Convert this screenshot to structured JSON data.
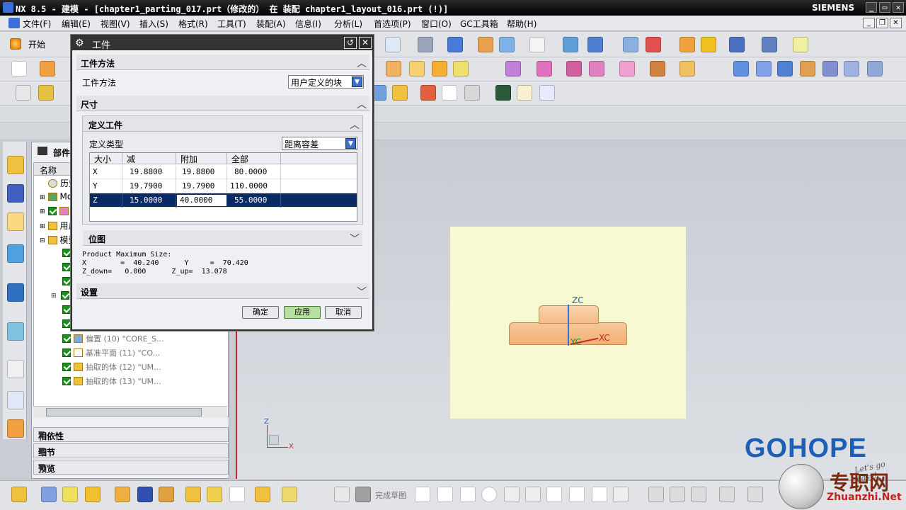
{
  "window": {
    "title": "NX 8.5 - 建模 - [chapter1_parting_017.prt（修改的） 在 装配 chapter1_layout_016.prt (!)]",
    "brand": "SIEMENS"
  },
  "menu": [
    "文件(F)",
    "编辑(E)",
    "视图(V)",
    "插入(S)",
    "格式(R)",
    "工具(T)",
    "装配(A)",
    "信息(I)",
    "分析(L)",
    "首选项(P)",
    "窗口(O)",
    "GC工具箱",
    "帮助(H)"
  ],
  "toolbar": {
    "start_label": "开始"
  },
  "navigator": {
    "title": "部件",
    "column_name": "名称",
    "rows": [
      {
        "label": "历史",
        "kind": "dark"
      },
      {
        "label": "Mod",
        "kind": "dark"
      },
      {
        "label": "",
        "kind": "dark"
      },
      {
        "label": "用户",
        "kind": "dark"
      },
      {
        "label": "模型",
        "kind": "dark"
      },
      {
        "label": "偏置 (10) \"CORE_S...",
        "kind": "grey"
      },
      {
        "label": "基准平面 (11) \"CO...",
        "kind": "grey"
      },
      {
        "label": "抽取的体 (12) \"UM...",
        "kind": "grey"
      },
      {
        "label": "抽取的体 (13) \"UM...",
        "kind": "grey"
      }
    ],
    "sections": [
      "相依性",
      "细节",
      "预览"
    ]
  },
  "dialog": {
    "title": "工件",
    "group_method": "工件方法",
    "method_label": "工件方法",
    "method_value": "用户定义的块",
    "group_size": "尺寸",
    "group_define": "定义工件",
    "def_type_label": "定义类型",
    "def_type_value": "距离容差",
    "table": {
      "headers": [
        "大小",
        "减",
        "附加",
        "全部"
      ],
      "rows": [
        {
          "axis": "X",
          "minus": "19.8800",
          "plus": "19.8800",
          "total": "80.0000"
        },
        {
          "axis": "Y",
          "minus": "19.7900",
          "plus": "19.7900",
          "total": "110.0000"
        },
        {
          "axis": "Z",
          "minus": "15.0000",
          "plus": "40.0000",
          "total": "55.0000"
        }
      ]
    },
    "group_position": "位图",
    "product_info": {
      "line1": "Product Maximum Size:",
      "line2": "X        =  40.240      Y     =  70.420",
      "line3": "Z_down=   0.000      Z_up=  13.078"
    },
    "group_settings": "设置",
    "buttons": {
      "ok": "确定",
      "apply": "应用",
      "cancel": "取消"
    }
  },
  "viewport": {
    "zc_label": "ZC",
    "xc_label": "XC",
    "yc_label": "YC",
    "triad_z": "Z",
    "triad_x": "X"
  },
  "bottombar": {
    "finish_sketch": "完成草图"
  },
  "watermark": {
    "logo": "GOHOPE",
    "site_zh": "专职网",
    "site_url": "Zhuanzhi.Net",
    "slogan": "Let's go easy!"
  },
  "colors": {
    "selection": "#0a2a66",
    "workpiece": "#f8f8d2",
    "part": "#f0b071",
    "logo": "#1c5fb5"
  }
}
